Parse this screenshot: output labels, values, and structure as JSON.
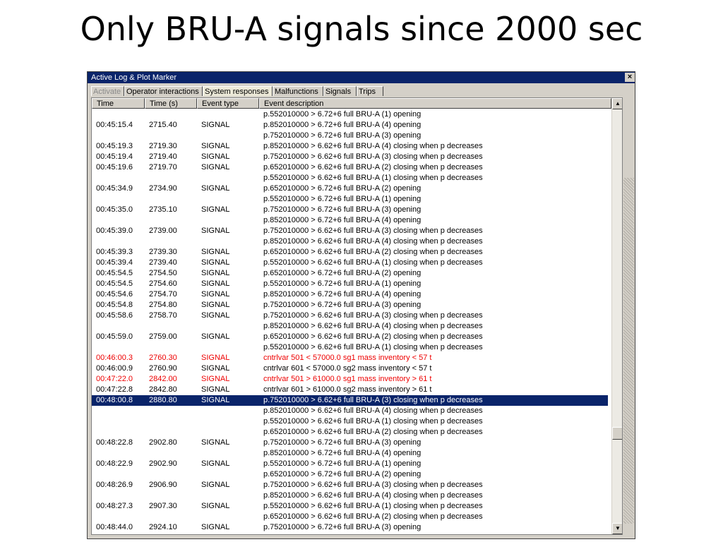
{
  "slide": {
    "title": "Only BRU-A signals since 2000 sec"
  },
  "window": {
    "title": "Active Log & Plot Marker",
    "close_glyph": "×"
  },
  "tabs": [
    {
      "label": "Activate"
    },
    {
      "label": "Operator interactions"
    },
    {
      "label": "System responses"
    },
    {
      "label": "Malfunctions"
    },
    {
      "label": "Signals"
    },
    {
      "label": "Trips"
    }
  ],
  "table": {
    "columns": [
      "Time",
      "Time (s)",
      "Event type",
      "Event description"
    ],
    "rows": [
      {
        "time": "",
        "time_s": "",
        "type": "",
        "desc": "p.552010000 > 6.72+6  full BRU-A (1) opening"
      },
      {
        "time": "00:45:15.4",
        "time_s": "2715.40",
        "type": "SIGNAL",
        "desc": "p.852010000 > 6.72+6  full BRU-A (4) opening"
      },
      {
        "time": "",
        "time_s": "",
        "type": "",
        "desc": "p.752010000 > 6.72+6  full BRU-A (3) opening"
      },
      {
        "time": "00:45:19.3",
        "time_s": "2719.30",
        "type": "SIGNAL",
        "desc": "p.852010000 > 6.62+6  full BRU-A (4) closing when p decreases"
      },
      {
        "time": "00:45:19.4",
        "time_s": "2719.40",
        "type": "SIGNAL",
        "desc": "p.752010000 > 6.62+6  full BRU-A (3) closing when p decreases"
      },
      {
        "time": "00:45:19.6",
        "time_s": "2719.70",
        "type": "SIGNAL",
        "desc": "p.652010000 > 6.62+6  full BRU-A (2) closing when p decreases"
      },
      {
        "time": "",
        "time_s": "",
        "type": "",
        "desc": "p.552010000 > 6.62+6  full BRU-A (1) closing when p decreases"
      },
      {
        "time": "00:45:34.9",
        "time_s": "2734.90",
        "type": "SIGNAL",
        "desc": "p.652010000 > 6.72+6  full BRU-A (2) opening"
      },
      {
        "time": "",
        "time_s": "",
        "type": "",
        "desc": "p.552010000 > 6.72+6  full BRU-A (1) opening"
      },
      {
        "time": "00:45:35.0",
        "time_s": "2735.10",
        "type": "SIGNAL",
        "desc": "p.752010000 > 6.72+6  full BRU-A (3) opening"
      },
      {
        "time": "",
        "time_s": "",
        "type": "",
        "desc": "p.852010000 > 6.72+6  full BRU-A (4) opening"
      },
      {
        "time": "00:45:39.0",
        "time_s": "2739.00",
        "type": "SIGNAL",
        "desc": "p.752010000 > 6.62+6  full BRU-A (3) closing when p decreases"
      },
      {
        "time": "",
        "time_s": "",
        "type": "",
        "desc": "p.852010000 > 6.62+6  full BRU-A (4) closing when p decreases"
      },
      {
        "time": "00:45:39.3",
        "time_s": "2739.30",
        "type": "SIGNAL",
        "desc": "p.652010000 > 6.62+6  full BRU-A (2) closing when p decreases"
      },
      {
        "time": "00:45:39.4",
        "time_s": "2739.40",
        "type": "SIGNAL",
        "desc": "p.552010000 > 6.62+6  full BRU-A (1) closing when p decreases"
      },
      {
        "time": "00:45:54.5",
        "time_s": "2754.50",
        "type": "SIGNAL",
        "desc": "p.652010000 > 6.72+6  full BRU-A (2) opening"
      },
      {
        "time": "00:45:54.5",
        "time_s": "2754.60",
        "type": "SIGNAL",
        "desc": "p.552010000 > 6.72+6  full BRU-A (1) opening"
      },
      {
        "time": "00:45:54.6",
        "time_s": "2754.70",
        "type": "SIGNAL",
        "desc": "p.852010000 > 6.72+6  full BRU-A (4) opening"
      },
      {
        "time": "00:45:54.8",
        "time_s": "2754.80",
        "type": "SIGNAL",
        "desc": "p.752010000 > 6.72+6  full BRU-A (3) opening"
      },
      {
        "time": "00:45:58.6",
        "time_s": "2758.70",
        "type": "SIGNAL",
        "desc": "p.752010000 > 6.62+6  full BRU-A (3) closing when p decreases"
      },
      {
        "time": "",
        "time_s": "",
        "type": "",
        "desc": "p.852010000 > 6.62+6  full BRU-A (4) closing when p decreases"
      },
      {
        "time": "00:45:59.0",
        "time_s": "2759.00",
        "type": "SIGNAL",
        "desc": "p.652010000 > 6.62+6  full BRU-A (2) closing when p decreases"
      },
      {
        "time": "",
        "time_s": "",
        "type": "",
        "desc": "p.552010000 > 6.62+6  full BRU-A (1) closing when p decreases"
      },
      {
        "time": "00:46:00.3",
        "time_s": "2760.30",
        "type": "SIGNAL",
        "desc": "cntrlvar  501 < 57000.0  sg1 mass inventory < 57 t",
        "style": "red"
      },
      {
        "time": "00:46:00.9",
        "time_s": "2760.90",
        "type": "SIGNAL",
        "desc": "cntrlvar  601 < 57000.0  sg2 mass inventory < 57 t"
      },
      {
        "time": "00:47:22.0",
        "time_s": "2842.00",
        "type": "SIGNAL",
        "desc": "cntrlvar  501 > 61000.0  sg1 mass inventory > 61 t",
        "style": "red"
      },
      {
        "time": "00:47:22.8",
        "time_s": "2842.80",
        "type": "SIGNAL",
        "desc": "cntrlvar  601 > 61000.0  sg2 mass inventory > 61 t"
      },
      {
        "time": "00:48:00.8",
        "time_s": "2880.80",
        "type": "SIGNAL",
        "desc": "p.752010000 > 6.62+6  full BRU-A (3) closing when p decreases",
        "style": "sel"
      },
      {
        "time": "",
        "time_s": "",
        "type": "",
        "desc": "p.852010000 > 6.62+6  full BRU-A (4) closing when p decreases"
      },
      {
        "time": "",
        "time_s": "",
        "type": "",
        "desc": "p.552010000 > 6.62+6  full BRU-A (1) closing when p decreases"
      },
      {
        "time": "",
        "time_s": "",
        "type": "",
        "desc": "p.652010000 > 6.62+6  full BRU-A (2) closing when p decreases"
      },
      {
        "time": "00:48:22.8",
        "time_s": "2902.80",
        "type": "SIGNAL",
        "desc": "p.752010000 > 6.72+6  full BRU-A (3) opening"
      },
      {
        "time": "",
        "time_s": "",
        "type": "",
        "desc": "p.852010000 > 6.72+6  full BRU-A (4) opening"
      },
      {
        "time": "00:48:22.9",
        "time_s": "2902.90",
        "type": "SIGNAL",
        "desc": "p.552010000 > 6.72+6  full BRU-A (1) opening"
      },
      {
        "time": "",
        "time_s": "",
        "type": "",
        "desc": "p.652010000 > 6.72+6  full BRU-A (2) opening"
      },
      {
        "time": "00:48:26.9",
        "time_s": "2906.90",
        "type": "SIGNAL",
        "desc": "p.752010000 > 6.62+6  full BRU-A (3) closing when p decreases"
      },
      {
        "time": "",
        "time_s": "",
        "type": "",
        "desc": "p.852010000 > 6.62+6  full BRU-A (4) closing when p decreases"
      },
      {
        "time": "00:48:27.3",
        "time_s": "2907.30",
        "type": "SIGNAL",
        "desc": "p.552010000 > 6.62+6  full BRU-A (1) closing when p decreases"
      },
      {
        "time": "",
        "time_s": "",
        "type": "",
        "desc": "p.652010000 > 6.62+6  full BRU-A (2) closing when p decreases"
      },
      {
        "time": "00:48:44.0",
        "time_s": "2924.10",
        "type": "SIGNAL",
        "desc": "p.752010000 > 6.72+6  full BRU-A (3) opening"
      }
    ]
  },
  "scrollbar": {
    "up_glyph": "▲",
    "down_glyph": "▼"
  },
  "colors": {
    "titlebar": "#0a246a",
    "selection": "#0a246a",
    "alert_text": "#ee0000",
    "window_face": "#d4d0c8"
  }
}
